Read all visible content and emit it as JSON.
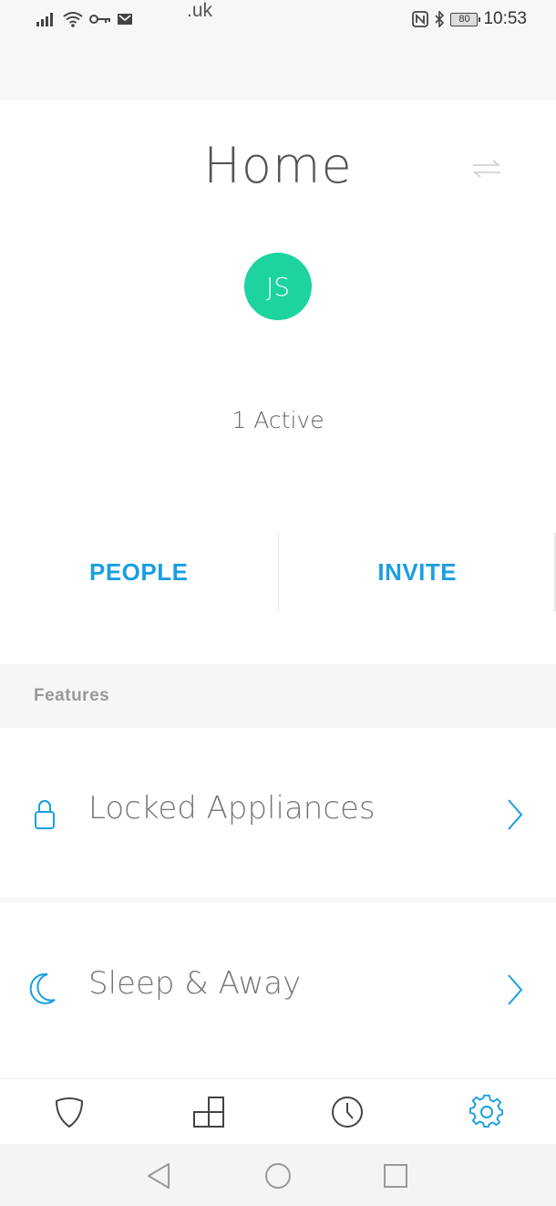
{
  "status_bar": {
    "carrier_text": ".uk",
    "battery": "80",
    "time": "10:53"
  },
  "header": {
    "title": "Home"
  },
  "user": {
    "initials": "JS",
    "avatar_color": "#1dd3a0"
  },
  "active_count": "1 Active",
  "actions": {
    "people": "PEOPLE",
    "invite": "INVITE"
  },
  "features": {
    "section_label": "Features",
    "items": [
      {
        "label": "Locked Appliances",
        "icon": "lock-icon"
      },
      {
        "label": "Sleep & Away",
        "icon": "moon-icon"
      }
    ]
  },
  "tabs": [
    {
      "icon": "shield-icon",
      "active": false
    },
    {
      "icon": "rooms-icon",
      "active": false
    },
    {
      "icon": "clock-icon",
      "active": false
    },
    {
      "icon": "gear-icon",
      "active": true
    }
  ],
  "colors": {
    "accent": "#1a9fe0",
    "avatar": "#1dd3a0",
    "inactive_icon": "#444444"
  }
}
